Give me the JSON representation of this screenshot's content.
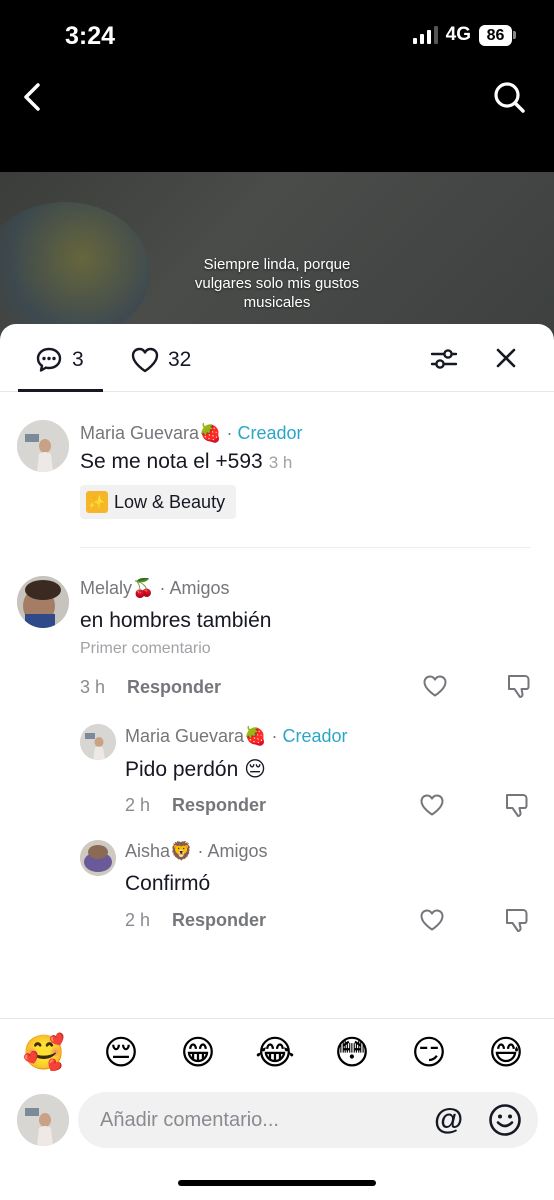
{
  "status_bar": {
    "time": "3:24",
    "network": "4G",
    "battery": "86"
  },
  "video": {
    "caption_lines": [
      "Siempre linda, porque",
      "vulgares solo mis gustos",
      "musicales"
    ]
  },
  "tabs": {
    "comments_count": "3",
    "likes_count": "32"
  },
  "comments": [
    {
      "author": "Maria Guevara🍓",
      "separator": "·",
      "badge": "Creador",
      "text": "Se me nota el +593",
      "time": "3 h",
      "chip": {
        "icon": "✨",
        "label": "Low & Beauty"
      }
    },
    {
      "author": "Melaly🍒",
      "separator": "·",
      "badge": "Amigos",
      "text": "en hombres también",
      "note": "Primer comentario",
      "time": "3 h",
      "reply_label": "Responder",
      "replies": [
        {
          "author": "Maria Guevara🍓",
          "separator": "·",
          "badge": "Creador",
          "text": "Pido perdón 😔",
          "time": "2 h",
          "reply_label": "Responder"
        },
        {
          "author": "Aisha🦁",
          "separator": "·",
          "badge": "Amigos",
          "text": "Confirmó",
          "time": "2 h",
          "reply_label": "Responder"
        }
      ]
    }
  ],
  "emoji_bar": [
    "🥰",
    "😔",
    "😁",
    "😂",
    "😳",
    "😏",
    "😅"
  ],
  "input": {
    "placeholder": "Añadir comentario...",
    "at_symbol": "@"
  },
  "colors": {
    "creator_badge": "#2aa6c9",
    "text_primary": "#161823",
    "text_secondary": "#75767b"
  }
}
